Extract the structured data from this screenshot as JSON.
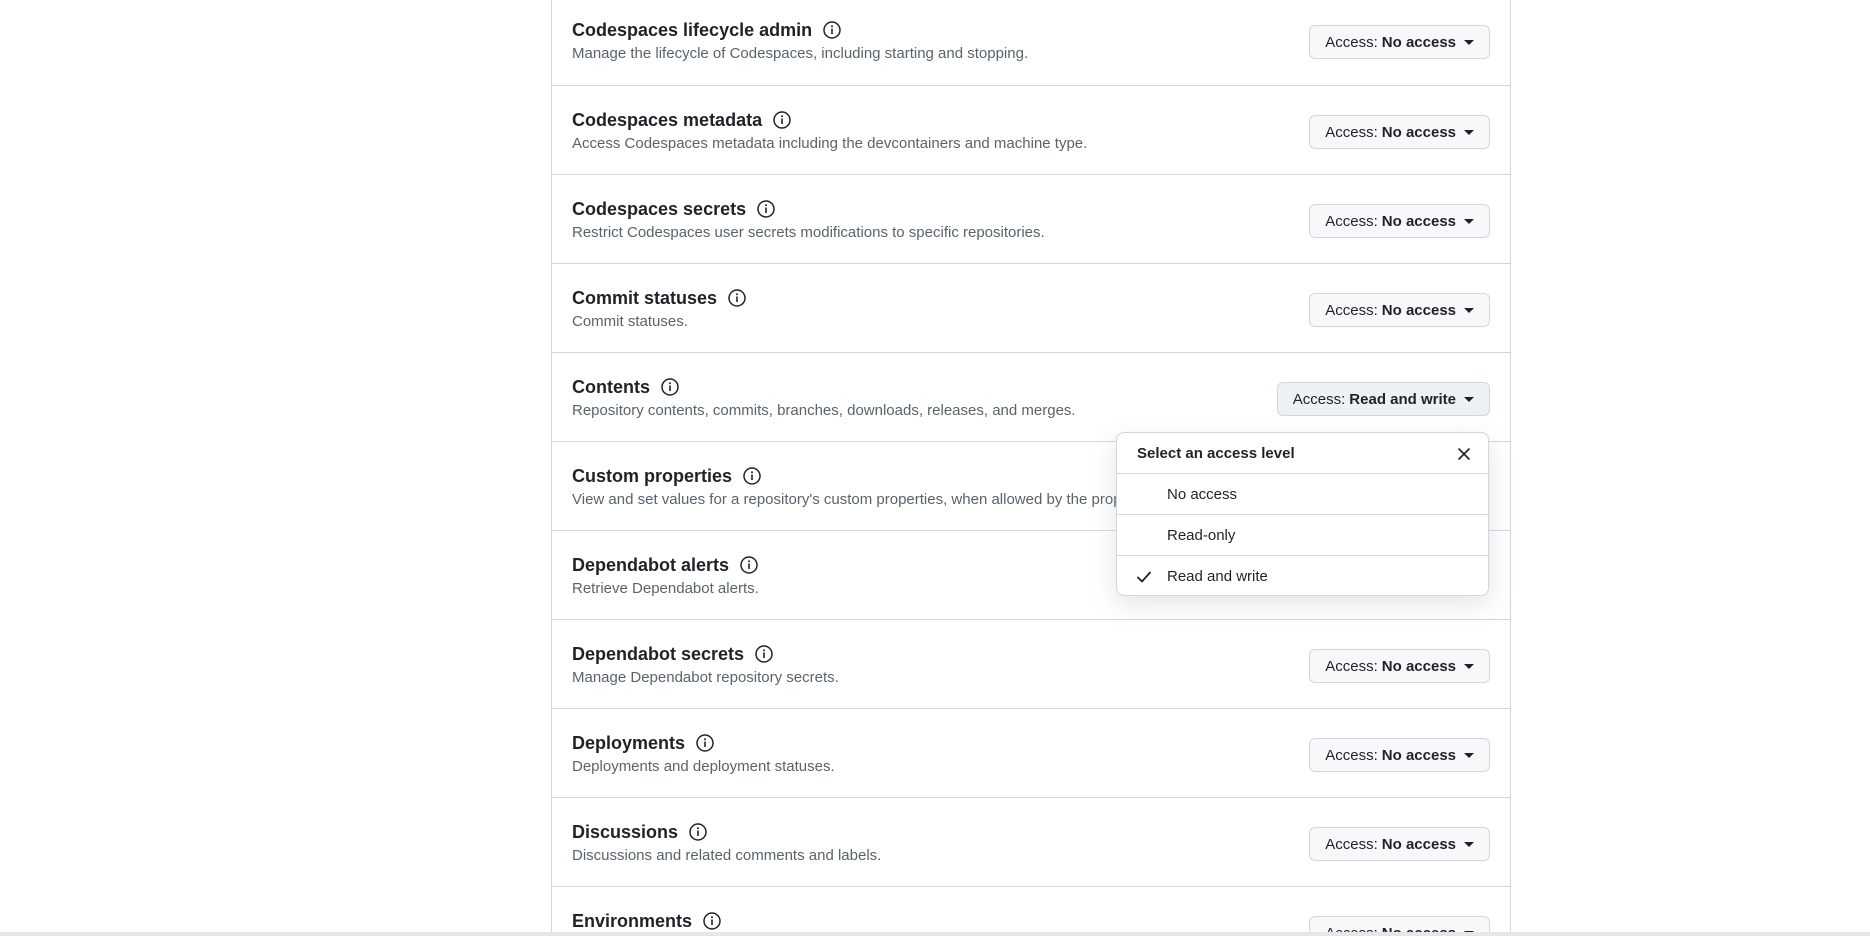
{
  "access_prefix": "Access:",
  "permissions": [
    {
      "title": "Codespaces lifecycle admin",
      "desc": "Manage the lifecycle of Codespaces, including starting and stopping.",
      "value": "No access"
    },
    {
      "title": "Codespaces metadata",
      "desc": "Access Codespaces metadata including the devcontainers and machine type.",
      "value": "No access"
    },
    {
      "title": "Codespaces secrets",
      "desc": "Restrict Codespaces user secrets modifications to specific repositories.",
      "value": "No access"
    },
    {
      "title": "Commit statuses",
      "desc": "Commit statuses.",
      "value": "No access"
    },
    {
      "title": "Contents",
      "desc": "Repository contents, commits, branches, downloads, releases, and merges.",
      "value": "Read and write"
    },
    {
      "title": "Custom properties",
      "desc": "View and set values for a repository's custom properties, when allowed by the prop",
      "value": ""
    },
    {
      "title": "Dependabot alerts",
      "desc": "Retrieve Dependabot alerts.",
      "value": ""
    },
    {
      "title": "Dependabot secrets",
      "desc": "Manage Dependabot repository secrets.",
      "value": "No access"
    },
    {
      "title": "Deployments",
      "desc": "Deployments and deployment statuses.",
      "value": "No access"
    },
    {
      "title": "Discussions",
      "desc": "Discussions and related comments and labels.",
      "value": "No access"
    },
    {
      "title": "Environments",
      "desc": "",
      "value": "No access"
    }
  ],
  "dropdown": {
    "title": "Select an access level",
    "options": [
      "No access",
      "Read-only",
      "Read and write"
    ],
    "selected": "Read and write"
  },
  "colors": {
    "border": "#d0d7de",
    "button_bg": "#f6f8fa",
    "muted_text": "#59636e",
    "text": "#1f2328"
  },
  "icons": {
    "info": "info-icon",
    "caret": "caret-down-icon",
    "close": "close-icon",
    "check": "check-icon"
  }
}
